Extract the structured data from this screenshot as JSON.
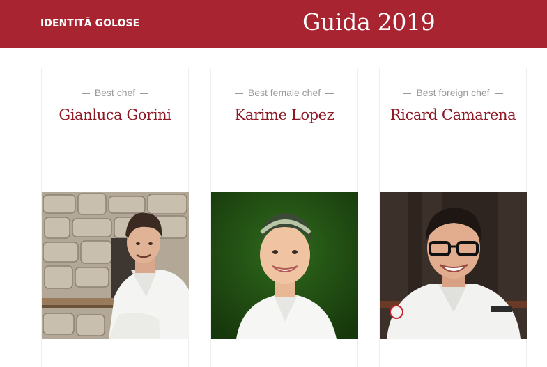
{
  "header": {
    "logo_text": "IDENTITĀ GOLOSE",
    "title": "Guida 2019",
    "background_color": "#a82430"
  },
  "cards": [
    {
      "award": "Best chef",
      "name": "Gianluca Gorini",
      "photo_icon": "chef-portrait-stone-wall"
    },
    {
      "award": "Best female chef",
      "name": "Karime Lopez",
      "photo_icon": "chef-portrait-green-backdrop"
    },
    {
      "award": "Best foreign chef",
      "name": "Ricard Camarena",
      "photo_icon": "chef-portrait-dark-backdrop"
    }
  ],
  "colors": {
    "name_color": "#8e1824",
    "award_color": "#9a9a9a"
  }
}
